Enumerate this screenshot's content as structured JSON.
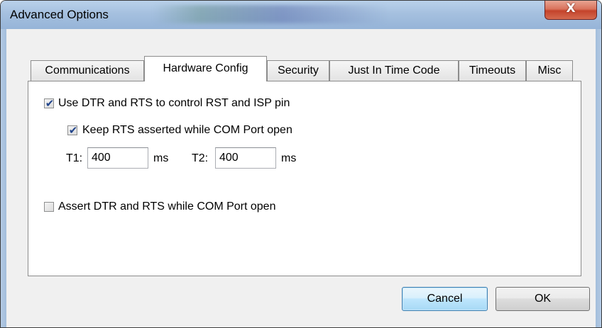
{
  "window": {
    "title": "Advanced Options",
    "close_glyph": "X"
  },
  "tabs": [
    {
      "label": "Communications",
      "active": false
    },
    {
      "label": "Hardware Config",
      "active": true
    },
    {
      "label": "Security",
      "active": false
    },
    {
      "label": "Just In Time Code",
      "active": false
    },
    {
      "label": "Timeouts",
      "active": false
    },
    {
      "label": "Misc",
      "active": false
    }
  ],
  "hardware": {
    "use_dtr_rts": {
      "label": "Use DTR and RTS to control RST and ISP pin",
      "checked": true
    },
    "keep_rts": {
      "label": "Keep RTS asserted while COM Port open",
      "checked": true
    },
    "t1": {
      "label": "T1:",
      "value": "400",
      "unit": "ms"
    },
    "t2": {
      "label": "T2:",
      "value": "400",
      "unit": "ms"
    },
    "assert_dtr_rts": {
      "label": "Assert DTR and RTS while COM Port open",
      "checked": false
    }
  },
  "buttons": {
    "cancel": "Cancel",
    "ok": "OK"
  },
  "colors": {
    "check_mark": "#21458c",
    "title_bar": "#a5c0df",
    "close_button": "#c4432b",
    "focused_button_border": "#3c7fb1"
  },
  "check_glyph": "✔"
}
